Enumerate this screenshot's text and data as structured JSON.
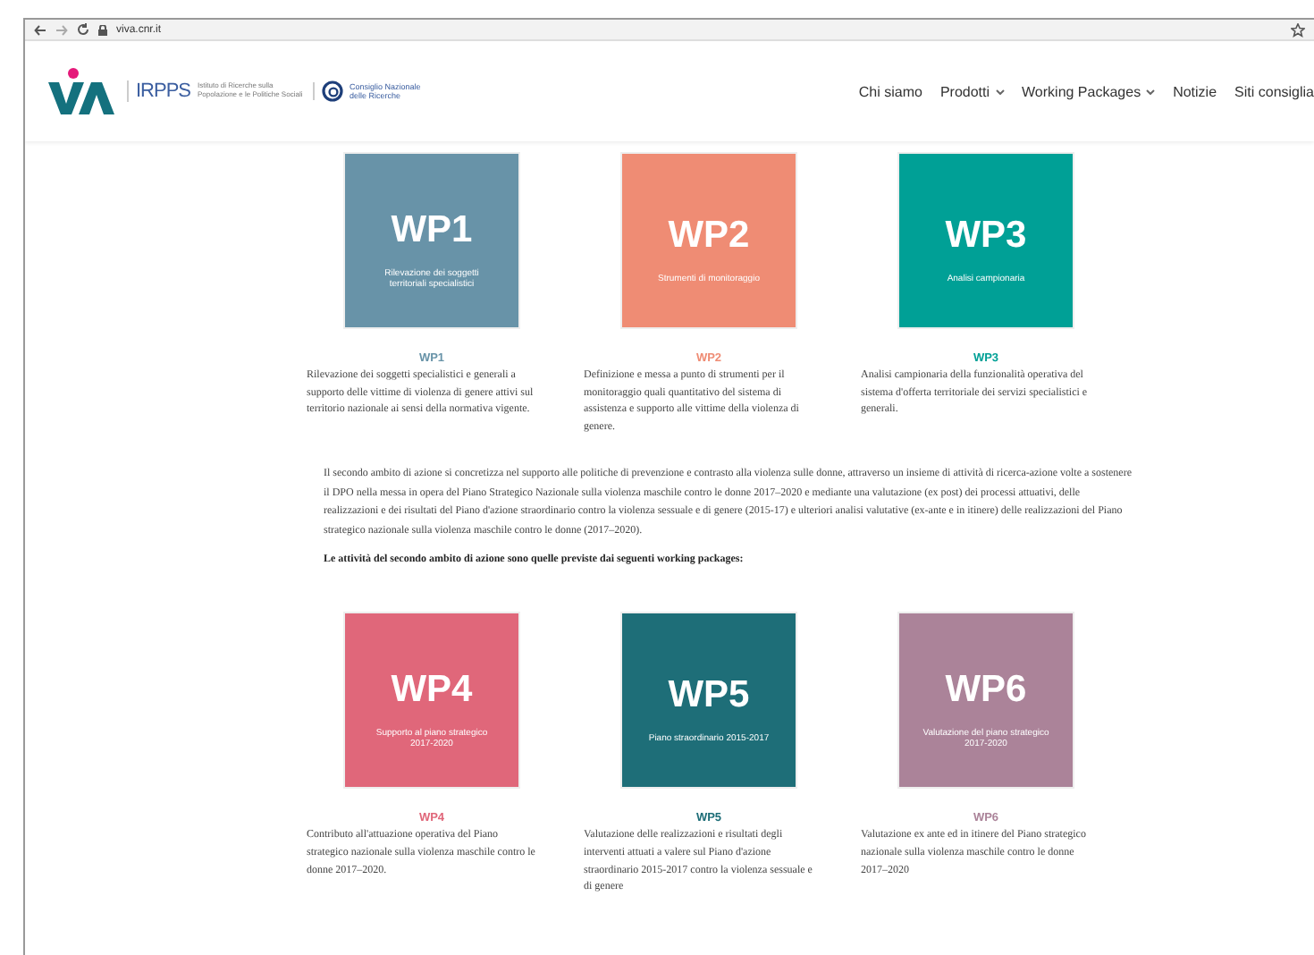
{
  "browser": {
    "url": "viva.cnr.it"
  },
  "header": {
    "irpps": "IRPPS",
    "irpps_caption": "Istituto di Ricerche sulla Popolazione e le Politiche Sociali",
    "cnr": "Consiglio Nazionale delle Ricerche",
    "nav": [
      {
        "label": "Chi siamo",
        "dropdown": false
      },
      {
        "label": "Prodotti",
        "dropdown": true
      },
      {
        "label": "Working Packages",
        "dropdown": true
      },
      {
        "label": "Notizie",
        "dropdown": false
      },
      {
        "label": "Siti consiglia",
        "dropdown": false
      }
    ]
  },
  "packages_first": [
    {
      "code": "WP1",
      "tile_code": "WP1",
      "subtitle": "Rilevazione dei soggetti territoriali specialistici",
      "color": "#6893a8",
      "description": "Rilevazione dei soggetti specialistici e generali a supporto delle vittime di violenza di genere attivi sul territorio nazionale ai sensi della normativa vigente."
    },
    {
      "code": "WP2",
      "tile_code": "WP2",
      "subtitle": "Strumenti di monitoraggio",
      "color": "#ef8c74",
      "description": "Definizione e messa a punto di strumenti per il monitoraggio quali quantitativo del sistema di assistenza e supporto alle vittime della violenza di genere."
    },
    {
      "code": "WP3",
      "tile_code": "WP3",
      "subtitle": "Analisi campionaria",
      "color": "#00a096",
      "description": "Analisi campionaria della funzionalità operativa del sistema d'offerta territoriale dei servizi specialistici e generali."
    }
  ],
  "intro": "Il secondo ambito di azione si concretizza nel supporto alle politiche di prevenzione e contrasto alla violenza sulle donne, attraverso un insieme di attività di ricerca-azione volte a sostenere il DPO nella messa in opera del Piano Strategico Nazionale sulla violenza maschile contro le donne 2017–2020 e mediante una valutazione (ex post) dei processi attuativi, delle realizzazioni e dei risultati del Piano d'azione straordinario contro la violenza sessuale e di genere (2015-17) e ulteriori analisi valutative (ex-ante e in itinere) delle realizzazioni del Piano strategico nazionale sulla violenza maschile contro le donne (2017–2020).",
  "lead": "Le attività del secondo ambito di azione sono quelle previste dai seguenti working packages:",
  "packages_second": [
    {
      "code": "WP4",
      "tile_code": "WP4",
      "subtitle": "Supporto al piano strategico 2017-2020",
      "color": "#e0677a",
      "description": "Contributo all'attuazione operativa del Piano strategico nazionale sulla violenza maschile contro le donne 2017–2020."
    },
    {
      "code": "WP5",
      "tile_code": "WP5",
      "subtitle": "Piano straordinario 2015-2017",
      "color": "#1e6e78",
      "description": "Valutazione delle realizzazioni e risultati degli interventi attuati a valere sul Piano d'azione straordinario 2015-2017 contro la violenza sessuale e di genere"
    },
    {
      "code": "WP6",
      "tile_code": "WP6",
      "subtitle": "Valutazione del piano strategico 2017-2020",
      "color": "#ab8399",
      "description": "Valutazione ex ante ed in itinere del Piano strategico nazionale sulla violenza maschile contro le donne 2017–2020"
    }
  ]
}
